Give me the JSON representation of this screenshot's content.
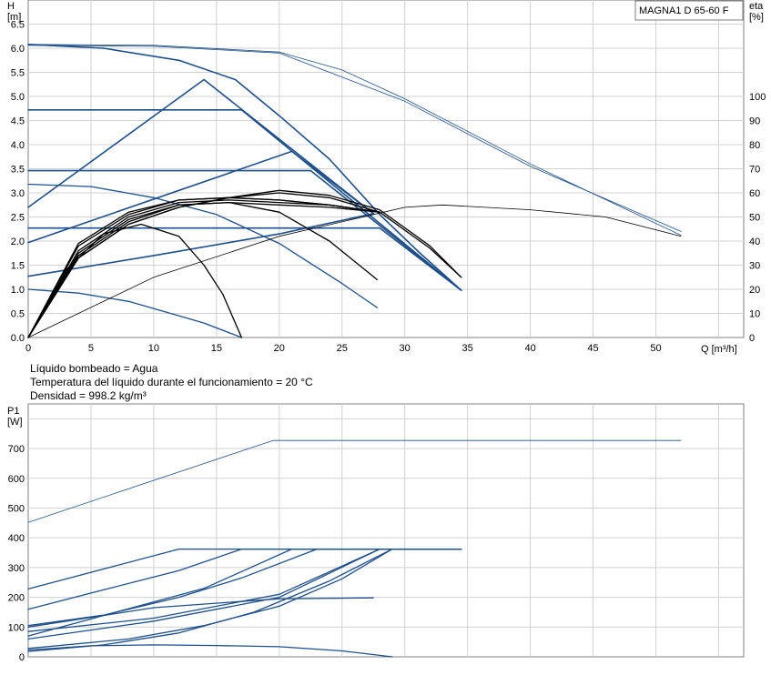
{
  "model_label": "MAGNA1 D 65-60 F",
  "notes": [
    "Líquido bombeado = Agua",
    "Temperatura del líquido durante el funcionamiento = 20 °C",
    "Densidad = 998.2 kg/m³"
  ],
  "colors": {
    "curve_blue": "#1f4f8a",
    "curve_black": "#000000",
    "grid": "#d0d0d0",
    "frame": "#808080"
  },
  "chart_data": [
    {
      "type": "line",
      "title": "",
      "ylabel": "H\n[m]",
      "y2label": "eta\n[%]",
      "xlabel": "Q [m³/h]",
      "xlim": [
        0,
        57
      ],
      "ylim": [
        0,
        7.0
      ],
      "y2lim": [
        0,
        140
      ],
      "x_ticks": [
        0,
        5,
        10,
        15,
        20,
        25,
        30,
        35,
        40,
        45,
        50
      ],
      "y_ticks": [
        0.0,
        0.5,
        1.0,
        1.5,
        2.0,
        2.5,
        3.0,
        3.5,
        4.0,
        4.5,
        5.0,
        5.5,
        6.0,
        6.5
      ],
      "y2_ticks": [
        0,
        10,
        20,
        30,
        40,
        50,
        60,
        70,
        80,
        90,
        100
      ],
      "grid": true,
      "series": [
        {
          "style": "blue",
          "width": 1.6,
          "x": [
            0,
            6,
            12,
            16.5,
            20,
            24,
            28,
            31,
            34.5
          ],
          "y": [
            6.08,
            6.0,
            5.75,
            5.35,
            4.6,
            3.7,
            2.55,
            1.8,
            0.98
          ]
        },
        {
          "style": "blue",
          "width": 1.6,
          "x": [
            0,
            17,
            34.5
          ],
          "y": [
            4.72,
            4.72,
            0.98
          ]
        },
        {
          "style": "blue",
          "width": 1.6,
          "x": [
            0,
            22.5,
            34.5
          ],
          "y": [
            3.46,
            3.46,
            0.98
          ]
        },
        {
          "style": "blue",
          "width": 1.6,
          "x": [
            0,
            28,
            34.5
          ],
          "y": [
            2.27,
            2.27,
            0.98
          ]
        },
        {
          "style": "blue",
          "width": 1.6,
          "x": [
            0,
            14,
            27.5
          ],
          "y": [
            2.7,
            5.35,
            2.57
          ]
        },
        {
          "style": "blue",
          "width": 1.6,
          "x": [
            0,
            21,
            27.5
          ],
          "y": [
            1.97,
            3.86,
            2.57
          ]
        },
        {
          "style": "blue",
          "width": 1.6,
          "x": [
            0,
            10,
            20,
            27.5
          ],
          "y": [
            1.27,
            1.7,
            2.15,
            2.57
          ]
        },
        {
          "style": "blue",
          "width": 1.3,
          "x": [
            0,
            5,
            10,
            15,
            20,
            25,
            27.8
          ],
          "y": [
            3.18,
            3.13,
            2.9,
            2.55,
            1.95,
            1.12,
            0.62
          ]
        },
        {
          "style": "blue",
          "width": 1.3,
          "x": [
            0,
            4,
            8,
            12,
            14,
            17
          ],
          "y": [
            1.0,
            0.92,
            0.75,
            0.45,
            0.3,
            0.0
          ]
        },
        {
          "style": "blue",
          "width": 0.8,
          "x": [
            0,
            10,
            20,
            25,
            30,
            40,
            52
          ],
          "y": [
            6.08,
            6.06,
            5.92,
            5.55,
            4.95,
            3.6,
            2.12
          ]
        },
        {
          "style": "blue",
          "width": 0.8,
          "x": [
            0,
            10,
            20,
            30,
            40,
            52
          ],
          "y": [
            6.06,
            6.04,
            5.9,
            4.9,
            3.55,
            2.2
          ]
        },
        {
          "style": "black",
          "width": 1.3,
          "axis": "y2",
          "x": [
            0,
            3,
            6,
            9,
            12,
            14,
            15.5,
            17
          ],
          "y": [
            0,
            28,
            43,
            47,
            42,
            30,
            18,
            0
          ]
        },
        {
          "style": "black",
          "width": 1.3,
          "axis": "y2",
          "x": [
            0,
            4,
            8,
            12,
            16,
            20,
            24,
            27.8
          ],
          "y": [
            0,
            34,
            48,
            55,
            56,
            52,
            40,
            24
          ]
        },
        {
          "style": "black",
          "width": 1.3,
          "axis": "y2",
          "x": [
            0,
            4,
            8,
            12,
            16,
            20,
            24,
            28,
            32,
            34.5
          ],
          "y": [
            0,
            33,
            47,
            54,
            58,
            60,
            58,
            52,
            37,
            25
          ]
        },
        {
          "style": "black",
          "width": 1.3,
          "axis": "y2",
          "x": [
            0,
            4,
            8,
            12,
            16,
            20,
            24,
            28,
            32,
            34.5
          ],
          "y": [
            0,
            33,
            47,
            54,
            58,
            61,
            59,
            53,
            38,
            25
          ]
        },
        {
          "style": "black",
          "width": 1.3,
          "axis": "y2",
          "x": [
            0,
            4,
            8,
            12,
            16,
            20,
            24,
            28
          ],
          "y": [
            0,
            35,
            49,
            55,
            56,
            55,
            54,
            52
          ]
        },
        {
          "style": "black",
          "width": 1.3,
          "axis": "y2",
          "x": [
            0,
            4,
            8,
            12,
            16,
            20,
            24,
            28
          ],
          "y": [
            0,
            36,
            50,
            56,
            57,
            56,
            55,
            52
          ]
        },
        {
          "style": "black",
          "width": 1.3,
          "axis": "y2",
          "x": [
            0,
            4,
            8,
            12,
            16,
            20,
            24,
            28
          ],
          "y": [
            0,
            38,
            51,
            57,
            58,
            57,
            55,
            52
          ]
        },
        {
          "style": "black",
          "width": 1.3,
          "axis": "y2",
          "x": [
            0,
            4,
            8,
            12,
            16,
            20,
            24,
            28
          ],
          "y": [
            0,
            39,
            52,
            57,
            58,
            57,
            55,
            52
          ]
        },
        {
          "style": "black",
          "width": 0.8,
          "axis": "y2",
          "x": [
            0,
            10,
            20,
            30,
            33,
            40,
            46,
            52
          ],
          "y": [
            0,
            25,
            42,
            54,
            55,
            53,
            50,
            42
          ]
        }
      ]
    },
    {
      "type": "line",
      "title": "",
      "ylabel": "P1\n[W]",
      "xlabel": "",
      "xlim": [
        0,
        57
      ],
      "ylim": [
        0,
        850
      ],
      "y_ticks": [
        0,
        100,
        200,
        300,
        400,
        500,
        600,
        700
      ],
      "grid": true,
      "series": [
        {
          "style": "blue",
          "width": 0.8,
          "x": [
            0,
            19.5,
            52
          ],
          "y": [
            452,
            727,
            727
          ]
        },
        {
          "style": "blue",
          "width": 1.3,
          "x": [
            0,
            12,
            34.5
          ],
          "y": [
            228,
            362,
            362
          ]
        },
        {
          "style": "blue",
          "width": 1.3,
          "x": [
            0,
            6,
            12,
            17,
            34.5
          ],
          "y": [
            160,
            225,
            290,
            362,
            362
          ]
        },
        {
          "style": "blue",
          "width": 1.3,
          "x": [
            0,
            6,
            12,
            17,
            23,
            34.5
          ],
          "y": [
            105,
            140,
            200,
            265,
            362,
            362
          ]
        },
        {
          "style": "blue",
          "width": 1.3,
          "x": [
            0,
            7,
            14,
            21,
            34.5
          ],
          "y": [
            70,
            150,
            230,
            362,
            362
          ]
        },
        {
          "style": "blue",
          "width": 1.3,
          "x": [
            0,
            10,
            20,
            28,
            34.5
          ],
          "y": [
            60,
            120,
            200,
            362,
            362
          ]
        },
        {
          "style": "blue",
          "width": 1.3,
          "x": [
            0,
            10,
            20,
            28,
            34.5
          ],
          "y": [
            85,
            130,
            210,
            362,
            362
          ]
        },
        {
          "style": "blue",
          "width": 1.3,
          "x": [
            0,
            10,
            20,
            27.5
          ],
          "y": [
            100,
            165,
            195,
            198
          ]
        },
        {
          "style": "blue",
          "width": 1.3,
          "x": [
            0,
            8,
            14,
            20,
            25,
            29
          ],
          "y": [
            28,
            60,
            105,
            170,
            262,
            362
          ]
        },
        {
          "style": "blue",
          "width": 1.3,
          "x": [
            0,
            6,
            12,
            18,
            24,
            29
          ],
          "y": [
            18,
            40,
            80,
            150,
            255,
            362
          ]
        },
        {
          "style": "blue",
          "width": 1.3,
          "x": [
            0,
            5,
            10,
            15,
            20,
            25,
            29
          ],
          "y": [
            23,
            37,
            40,
            38,
            34,
            20,
            0
          ]
        }
      ]
    }
  ]
}
